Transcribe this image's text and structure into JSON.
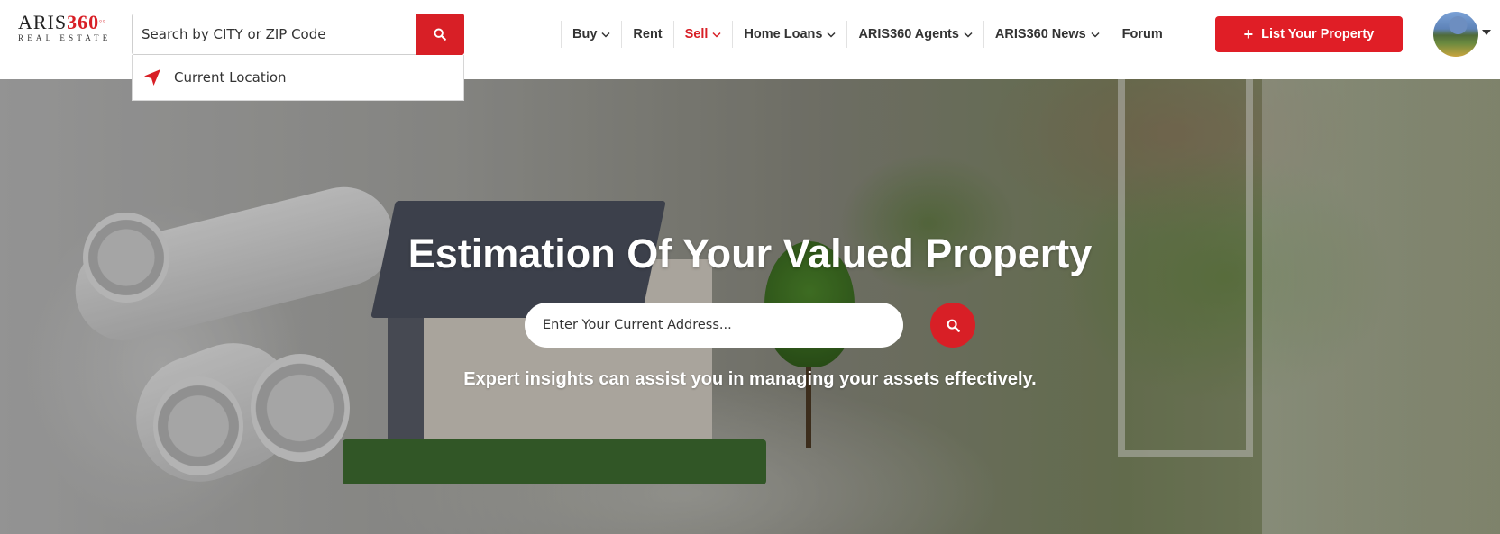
{
  "logo": {
    "main_text": "ARIS",
    "number": "360",
    "degree": "°°",
    "sub_text": "REAL ESTATE"
  },
  "search": {
    "placeholder": "Search by CITY or ZIP Code",
    "button_icon": "search-icon"
  },
  "dropdown": {
    "item_label": "Current Location",
    "item_icon": "location-arrow-icon"
  },
  "nav": {
    "items": [
      {
        "label": "Buy",
        "has_dropdown": true,
        "active": false
      },
      {
        "label": "Rent",
        "has_dropdown": false,
        "active": false
      },
      {
        "label": "Sell",
        "has_dropdown": true,
        "active": true
      },
      {
        "label": "Home Loans",
        "has_dropdown": true,
        "active": false
      },
      {
        "label": "ARIS360 Agents",
        "has_dropdown": true,
        "active": false
      },
      {
        "label": "ARIS360 News",
        "has_dropdown": true,
        "active": false
      },
      {
        "label": "Forum",
        "has_dropdown": false,
        "active": false
      }
    ]
  },
  "list_button": {
    "icon": "plus",
    "label": "List Your Property"
  },
  "hero": {
    "title": "Estimation Of Your Valued Property",
    "address_placeholder": "Enter Your Current Address...",
    "subtitle": "Expert insights can assist you in managing your assets effectively."
  },
  "colors": {
    "accent": "#d81f26",
    "nav_text": "#333333"
  }
}
